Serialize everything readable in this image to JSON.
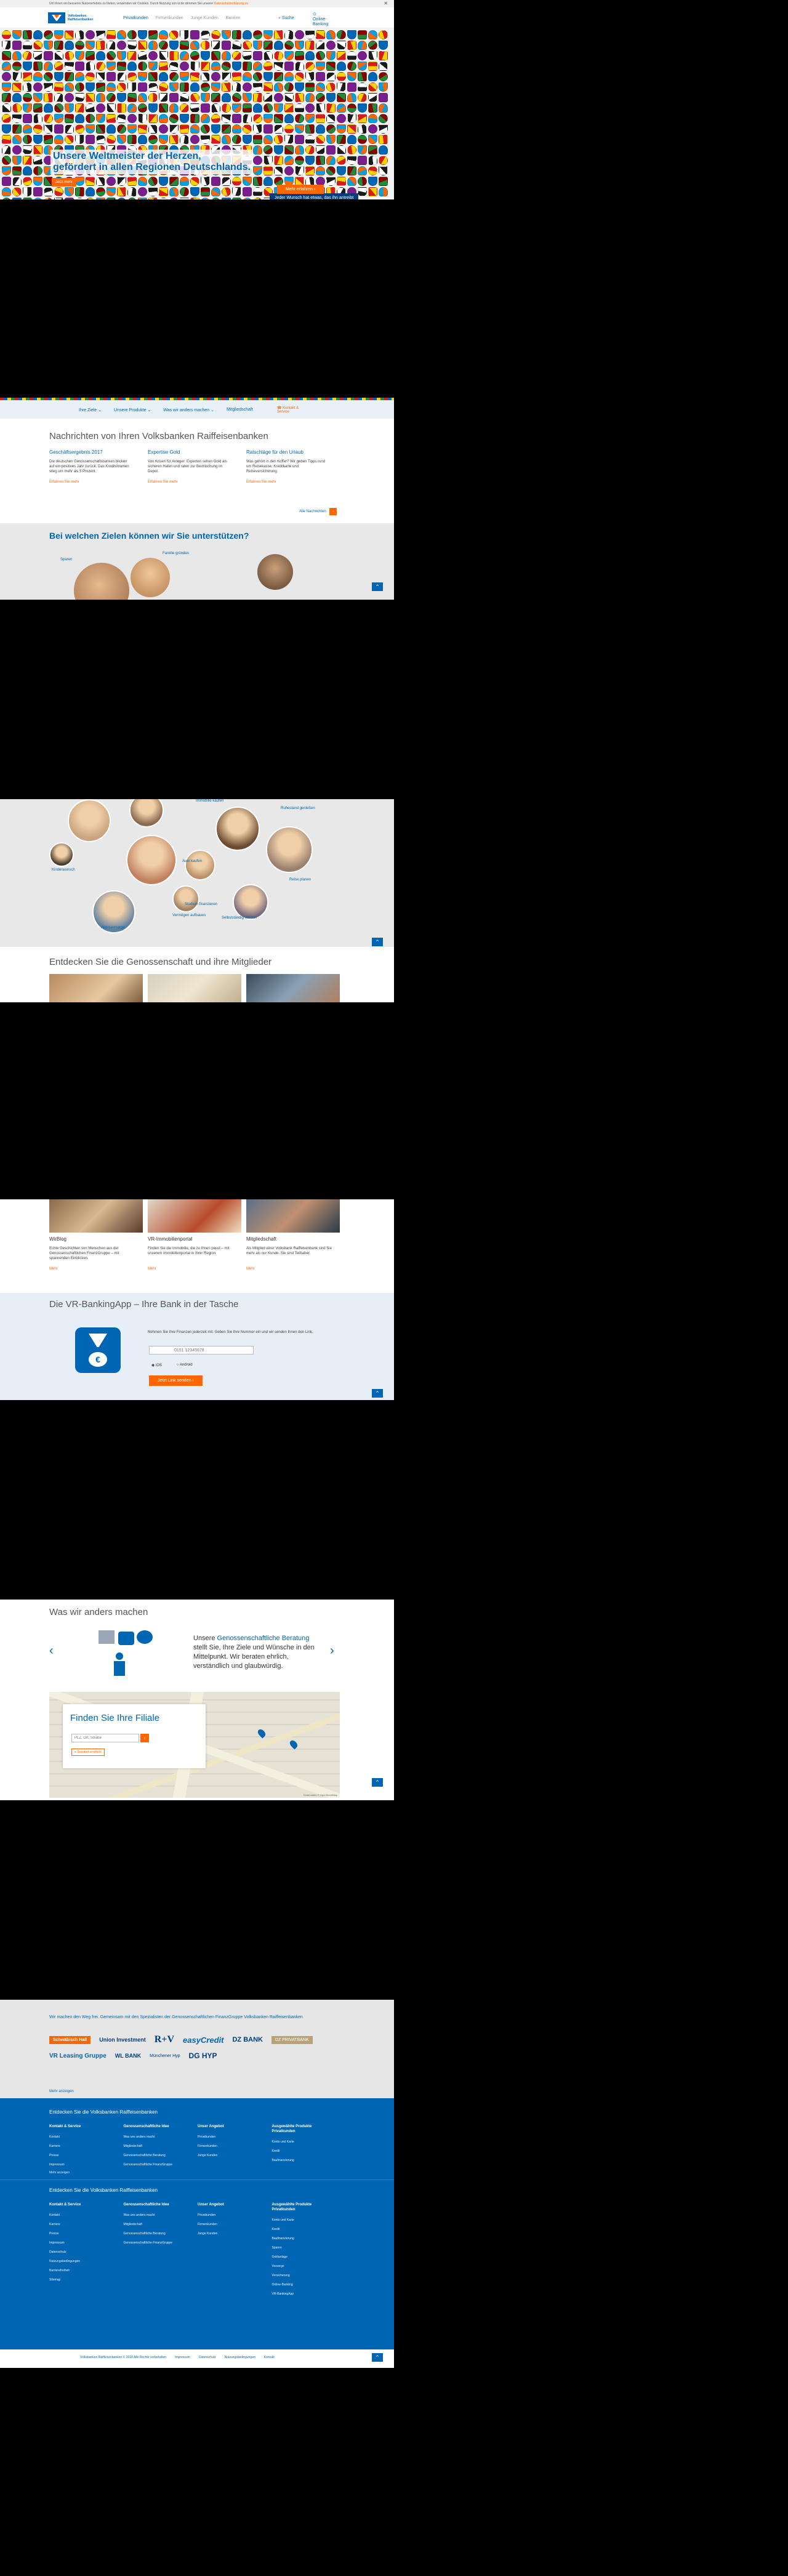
{
  "cookie_bar": {
    "text": "Um Ihnen ein besseres Nutzererlebnis zu bieten, verwenden wir Cookies. Durch Nutzung von vr.de stimmen Sie unserer",
    "link": "Datenschutzerklärung zu"
  },
  "header": {
    "logo_line1": "Volksbanken",
    "logo_line2": "Raiffeisenbanken",
    "nav": [
      "Privatkunden",
      "Firmenkunden",
      "Junge Kunden",
      "Banken"
    ],
    "search_label": "Suche",
    "banking_label1": "Online-",
    "banking_label2": "Banking"
  },
  "hero": {
    "headline_line1": "Unsere Weltmeister der Herzen,",
    "headline_line2": "gefördert in allen Regionen Deutschlands.",
    "left_button": "Jetzt mehr",
    "right_button": "Jeder Wunsch hat etwas, das ihn antreibt",
    "cta_button": "Mehr erfahren",
    "colors": [
      "#d71920",
      "#0066b3",
      "#f6d200",
      "#1a1a1a",
      "#1f8b3b",
      "#ff6600",
      "#7a1e8c",
      "#00a0e3",
      "#8b0000",
      "#ffffff"
    ]
  },
  "subnav": {
    "items": [
      "Ihre Ziele",
      "Unsere Produkte",
      "Was wir anders machen",
      "Mitgliedschaft"
    ],
    "contact": "Kontakt & Service"
  },
  "news": {
    "title": "Nachrichten von Ihren Volksbanken Raiffeisenbanken",
    "items": [
      {
        "title": "Geschäftsergebnis 2017",
        "text": "Die deutschen Genossenschaftsbanken blicken auf ein positives Jahr zurück. Das Kreditvolumen stieg um mehr als 5 Prozent.",
        "link": "Erfahren Sie mehr"
      },
      {
        "title": "Expertise Gold",
        "text": "Von Krisen für Anleger: Experten sehen Gold als sicheren Hafen und raten zur Beimischung im Depot.",
        "link": "Erfahren Sie mehr"
      },
      {
        "title": "Ratschläge für den Urlaub",
        "text": "Was gehört in den Koffer? Wir geben Tipps rund um Reisekasse, Kreditkarte und Reiseversicherung.",
        "link": "Erfahren Sie mehr"
      }
    ],
    "all_news": "Alle Nachrichten"
  },
  "goals": {
    "title": "Bei welchen Zielen können wir Sie unterstützen?",
    "items": [
      "Sparen",
      "Familie gründen",
      "Immobilie kaufen",
      "Ruhestand genießen",
      "Reise planen",
      "Auto kaufen",
      "Kinderwunsch",
      "Studium finanzieren",
      "Selbstständig werden",
      "Altersvorsorge",
      "Vermögen aufbauen",
      "Hochzeit feiern",
      "Traum erfüllen",
      "Absichern"
    ]
  },
  "discover": {
    "title": "Entdecken Sie die Genossenschaft und ihre Mitglieder",
    "items": [
      {
        "title": "WirBlog",
        "text": "Echte Geschichten von Menschen aus der Genossenschaftlichen FinanzGruppe – mit spannenden Einblicken.",
        "link": "Mehr"
      },
      {
        "title": "VR-Immobilienportal",
        "text": "Finden Sie die Immobilie, die zu Ihnen passt – mit unserem Immobilienportal in Ihrer Region.",
        "link": "Mehr"
      },
      {
        "title": "Mitgliedschaft",
        "text": "Als Mitglied einer Volksbank Raiffeisenbank sind Sie mehr als nur Kunde. Sie sind Teilhaber.",
        "link": "Mehr"
      }
    ]
  },
  "app": {
    "title": "Die VR-BankingApp – Ihre Bank in der Tasche",
    "text": "Nehmen Sie Ihre Finanzen jederzeit mit. Geben Sie Ihre Nummer ein und wir senden Ihnen den Link.",
    "phone_placeholder": "0151 12345678",
    "radio1": "iOS",
    "radio2": "Android",
    "button": "Jetzt Link senden"
  },
  "different": {
    "title": "Was wir anders machen",
    "text_prefix": "Unsere",
    "link": "Genossenschaftliche Beratung",
    "text_rest": "stellt Sie, Ihre Ziele und Wünsche in den Mittelpunkt. Wir beraten ehrlich, verständlich und glaubwürdig."
  },
  "branch": {
    "title": "Finden Sie Ihre Filiale",
    "placeholder": "PLZ, Ort, Straße",
    "locate": "Standort ermitteln",
    "map_credit": "Kartendaten © OpenStreetMap"
  },
  "partners": {
    "intro": "Wir machen den Weg frei. Gemeinsam mit den Spezialisten der Genossenschaftlichen FinanzGruppe Volksbanken Raiffeisenbanken",
    "logos": [
      "Schwäbisch Hall",
      "Union Investment",
      "R+V",
      "easyCredit",
      "DZ BANK",
      "DZ PRIVATBANK",
      "VR Leasing Gruppe",
      "WL BANK",
      "Münchener Hyp",
      "DG HYP"
    ],
    "more": "Mehr anzeigen"
  },
  "footer": {
    "title": "Entdecken Sie die Volksbanken Raiffeisenbanken",
    "columns": [
      {
        "heading": "Kontakt & Service",
        "links": [
          "Kontakt",
          "Karriere",
          "Presse",
          "Impressum",
          "Datenschutz",
          "Nutzungsbedingungen",
          "Barrierefreiheit",
          "Sitemap"
        ]
      },
      {
        "heading": "Genossenschaftliche Idee",
        "links": [
          "Was uns anders macht",
          "Mitgliedschaft",
          "Genossenschaftliche Beratung",
          "Genossenschaftliche FinanzGruppe"
        ]
      },
      {
        "heading": "Unser Angebot",
        "links": [
          "Privatkunden",
          "Firmenkunden",
          "Junge Kunden"
        ]
      },
      {
        "heading": "Ausgewählte Produkte Privatkunden",
        "links": [
          "Konto und Karte",
          "Kredit",
          "Baufinanzierung",
          "Sparen",
          "Geldanlage",
          "Vorsorge",
          "Versicherung",
          "Online-Banking",
          "VR-BankingApp"
        ]
      }
    ],
    "show_more": "Mehr anzeigen"
  },
  "bottom_bar": {
    "links": [
      "Volksbanken Raiffeisenbanken © 2018 Alle Rechte vorbehalten",
      "Impressum",
      "Datenschutz",
      "Nutzungsbedingungen",
      "Kontakt"
    ]
  }
}
